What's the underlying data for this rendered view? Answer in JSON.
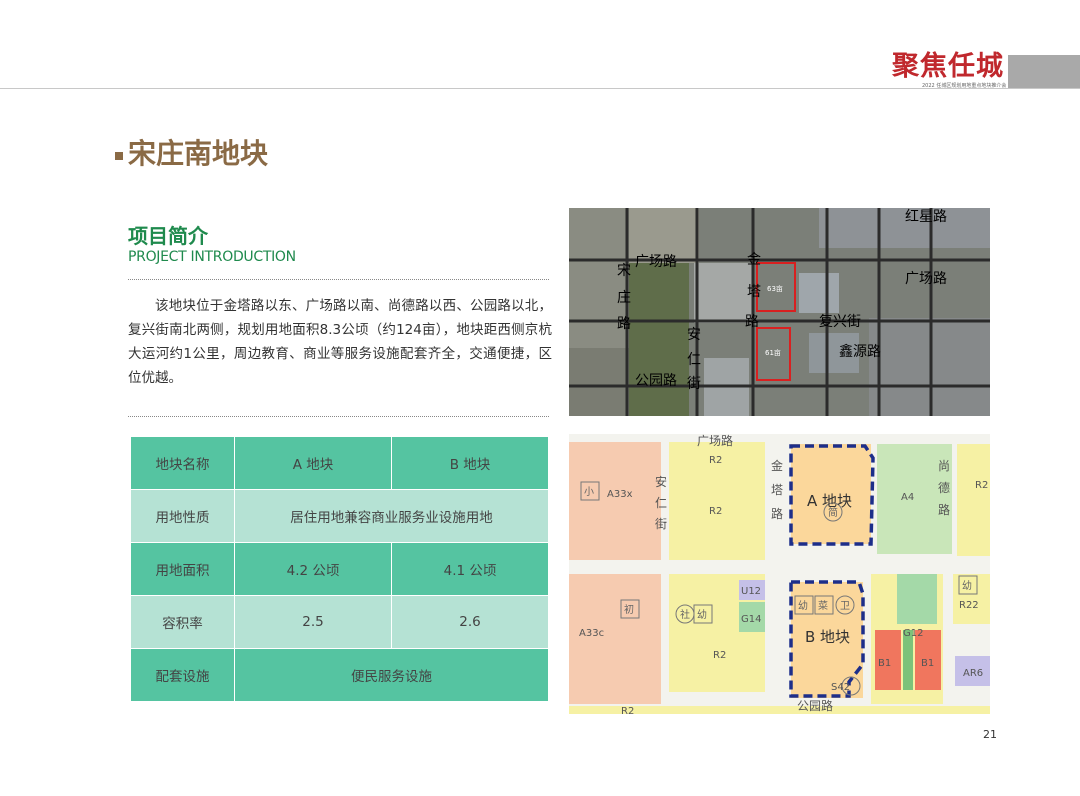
{
  "header": {
    "logo_text": "聚焦任城",
    "logo_subtitle": "2022 任城区规划用地重点地块推介会"
  },
  "page_title": "宋庄南地块",
  "intro": {
    "heading_cn": "项目简介",
    "heading_en": "PROJECT INTRODUCTION",
    "description": "该地块位于金塔路以东、广场路以南、尚德路以西、公园路以北，复兴街南北两侧，规划用地面积8.3公顷（约124亩），地块距西侧京杭大运河约1公里，周边教育、商业等服务设施配套齐全，交通便捷，区位优越。"
  },
  "table": {
    "rows": [
      {
        "label": "地块名称",
        "a": "A 地块",
        "b": "B 地块"
      },
      {
        "label": "用地性质",
        "merged": "居住用地兼容商业服务业设施用地"
      },
      {
        "label": "用地面积",
        "a": "4.2 公顷",
        "b": "4.1 公顷"
      },
      {
        "label": "容积率",
        "a": "2.5",
        "b": "2.6"
      },
      {
        "label": "配套设施",
        "merged": "便民服务设施"
      }
    ]
  },
  "satellite_map": {
    "road_labels": {
      "hongxing": "红星路",
      "guangchang_left": "广场路",
      "guangchang_right": "广场路",
      "jinta": [
        "金",
        "塔",
        "路"
      ],
      "songzhuang": [
        "宋",
        "庄",
        "路"
      ],
      "anren": [
        "安",
        "仁",
        "街"
      ],
      "fuxing": "复兴街",
      "xinyuan": "鑫源路",
      "gongyuan": "公园路"
    },
    "parcel_a_tag": "63亩",
    "parcel_b_tag": "61亩"
  },
  "plan_map": {
    "road_labels": {
      "guangchang": "广场路",
      "jinta": [
        "金",
        "塔",
        "路"
      ],
      "anren": [
        "安",
        "仁",
        "街"
      ],
      "shangde": [
        "尚",
        "德",
        "路"
      ],
      "gongyuan": "公园路"
    },
    "parcel_a": "A 地块",
    "parcel_b": "B 地块",
    "zone_codes": {
      "a33x": "A33x",
      "r2_top": "R2",
      "r2_mid": "R2",
      "a4": "A4",
      "r2_right": "R2",
      "a33c": "A33c",
      "r2_bottom": "R2",
      "u12": "U12",
      "g14": "G14",
      "g12": "G12",
      "b1_left": "B1",
      "b1_right": "B1",
      "r22": "R22",
      "ar6": "AR6",
      "s42": "S42",
      "r2_footer": "R2"
    },
    "symbols": {
      "xiao": "小",
      "chu": "初",
      "you_a": "幼",
      "you_right": "幼",
      "cai": "菜",
      "she": "社",
      "wei": "卫",
      "jian": "简"
    }
  },
  "page_number": "21"
}
